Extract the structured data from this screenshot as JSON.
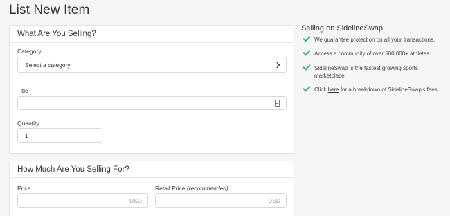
{
  "page": {
    "title": "List New Item"
  },
  "selling_card": {
    "header": "What Are You Selling?",
    "category_label": "Category",
    "category_value": "Select a category",
    "title_label": "Title",
    "title_value": "",
    "quantity_label": "Quantity",
    "quantity_value": "1"
  },
  "price_card": {
    "header": "How Much Are You Selling For?",
    "price_label": "Price",
    "price_suffix": "USD",
    "retail_label": "Retail Price",
    "retail_note": "(recommended)",
    "retail_suffix": "USD"
  },
  "sidebar": {
    "title": "Selling on SidelineSwap",
    "benefits": [
      "We guarantee protection on all your transactions.",
      "Access a community of over 500,000+ athletes.",
      "SidelineSwap is the fastest growing sports marketplace."
    ],
    "fees": {
      "prefix": "Click",
      "link": "here",
      "suffix": "for a breakdown of SidelineSwap's fees ."
    }
  },
  "colors": {
    "check": "#2bb673",
    "background": "#f6f6f6"
  }
}
